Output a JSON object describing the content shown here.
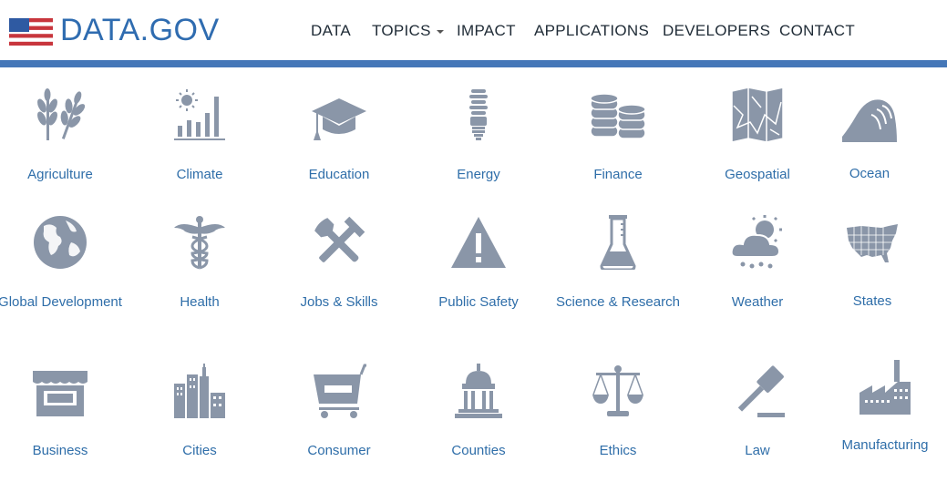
{
  "brand": {
    "wordmark": "DATA.GOV"
  },
  "nav": {
    "items": [
      {
        "label": "DATA"
      },
      {
        "label": "TOPICS"
      },
      {
        "label": "IMPACT"
      },
      {
        "label": "APPLICATIONS"
      },
      {
        "label": "DEVELOPERS"
      },
      {
        "label": "CONTACT"
      }
    ]
  },
  "colors": {
    "accent": "#4577b8",
    "icon": "#8a96a8",
    "link": "#2f6ea9",
    "nav_text": "#1f2b36"
  },
  "topics": [
    {
      "label": "Agriculture",
      "icon": "wheat-icon"
    },
    {
      "label": "Climate",
      "icon": "climate-icon"
    },
    {
      "label": "Education",
      "icon": "graduation-cap-icon"
    },
    {
      "label": "Energy",
      "icon": "lightbulb-icon"
    },
    {
      "label": "Finance",
      "icon": "coins-icon"
    },
    {
      "label": "Geospatial",
      "icon": "map-icon"
    },
    {
      "label": "Ocean",
      "icon": "wave-icon"
    },
    {
      "label": "Global Development",
      "icon": "globe-icon"
    },
    {
      "label": "Health",
      "icon": "caduceus-icon"
    },
    {
      "label": "Jobs & Skills",
      "icon": "tools-icon"
    },
    {
      "label": "Public Safety",
      "icon": "warning-icon"
    },
    {
      "label": "Science & Research",
      "icon": "beaker-icon"
    },
    {
      "label": "Weather",
      "icon": "weather-icon"
    },
    {
      "label": "States",
      "icon": "usa-map-icon"
    },
    {
      "label": "Business",
      "icon": "storefront-icon"
    },
    {
      "label": "Cities",
      "icon": "city-icon"
    },
    {
      "label": "Consumer",
      "icon": "shopping-cart-icon"
    },
    {
      "label": "Counties",
      "icon": "capitol-icon"
    },
    {
      "label": "Ethics",
      "icon": "scales-icon"
    },
    {
      "label": "Law",
      "icon": "gavel-icon"
    },
    {
      "label": "Manufacturing",
      "icon": "factory-icon"
    }
  ]
}
